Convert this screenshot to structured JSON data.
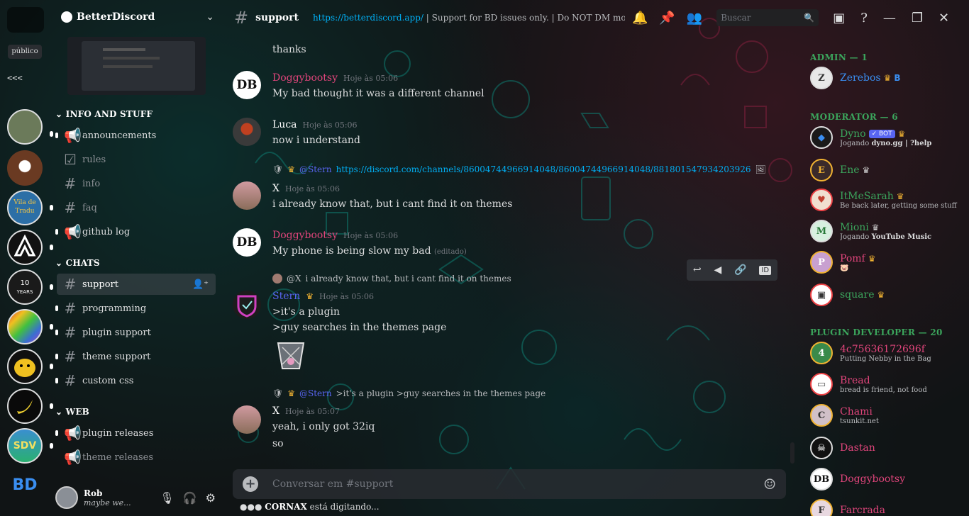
{
  "rail": {
    "publico_label": "público",
    "collapse_label": "<<<",
    "servers": [
      {
        "name": "server-landscape",
        "color": "#6b7a5a"
      },
      {
        "name": "server-flower",
        "color": "#6a3a22"
      },
      {
        "name": "server-vila-tradu",
        "label": "Vila\nTradu",
        "color": "#2c6fa6"
      },
      {
        "name": "server-arch",
        "color": "#111111"
      },
      {
        "name": "server-10-years",
        "label": "10 YEARS",
        "color": "#1a1a1a"
      },
      {
        "name": "server-plug",
        "color": "#3a6fd0"
      },
      {
        "name": "server-bird",
        "color": "#f0c020"
      },
      {
        "name": "server-banana",
        "color": "#0a0a0a"
      },
      {
        "name": "server-sdv",
        "label": "SDV",
        "color": "#3a8fd0"
      },
      {
        "name": "server-bd",
        "label": "BD",
        "color": "#3a8ef0"
      }
    ]
  },
  "sidebar": {
    "guild_name": "BetterDiscord",
    "categories": [
      {
        "label": "INFO AND STUFF"
      },
      {
        "label": "CHATS"
      },
      {
        "label": "WEB"
      }
    ],
    "channels": {
      "announcements": "announcements",
      "rules": "rules",
      "info": "info",
      "faq": "faq",
      "github_log": "github log",
      "support": "support",
      "programming": "programming",
      "plugin_support": "plugin support",
      "theme_support": "theme support",
      "custom_css": "custom css",
      "plugin_releases": "plugin releases",
      "theme_releases": "theme releases"
    },
    "user": {
      "name": "Rob",
      "status": "maybe we..."
    }
  },
  "topbar": {
    "channel": "support",
    "topic_link": "https://betterdiscord.app/",
    "topic_text": " | Support for BD issues only. | Do NOT DM mods/use...",
    "search_placeholder": "Buscar"
  },
  "messages": [
    {
      "key": "m0",
      "body": "thanks"
    },
    {
      "key": "m1",
      "author": "Doggybootsy",
      "author_color": "#e0457b",
      "time": "Hoje às 05:06",
      "body": "My bad thought it was a different channel"
    },
    {
      "key": "m2",
      "author": "Luca",
      "author_color": "#ffffff",
      "time": "Hoje às 05:06",
      "body": "now i understand"
    },
    {
      "key": "m3",
      "reply_to": "@Stern",
      "reply_link": "https://discord.com/channels/86004744966914048/86004744966914048/881801547934203926",
      "author": "X",
      "author_color": "#ffffff",
      "time": "Hoje às 05:06",
      "body": "i already know that, but i cant find it on themes"
    },
    {
      "key": "m4",
      "author": "Doggybootsy",
      "author_color": "#e0457b",
      "time": "Hoje às 05:06",
      "body": "My phone is being slow my bad",
      "edited": "(editado)"
    },
    {
      "key": "m5",
      "reply_to": "@X",
      "reply_text": "i already know that, but i cant find it on themes",
      "author": "Stern",
      "author_color": "#5865f2",
      "time": "Hoje às 05:06",
      "body1": ">it's a plugin",
      "body2": ">guy searches in the themes page"
    },
    {
      "key": "m6",
      "reply_to": "@Stern",
      "reply_text": ">it's a plugin >guy searches in the themes page",
      "author": "X",
      "author_color": "#ffffff",
      "time": "Hoje às 05:07",
      "body1": "yeah, i only got 32iq",
      "body2": "so"
    }
  ],
  "composer": {
    "placeholder": "Conversar em #support"
  },
  "typing": {
    "user": "CORNAX",
    "text": " está digitando..."
  },
  "members": {
    "roles": [
      {
        "label": "ADMIN — 1"
      },
      {
        "label": "MODERATOR — 6"
      },
      {
        "label": "PLUGIN DEVELOPER — 20"
      }
    ],
    "list": [
      {
        "name": "Zerebos",
        "color": "#3a8ef0",
        "activity": ""
      },
      {
        "name": "Dyno",
        "color": "#3ba55c",
        "badge": "BOT",
        "activity_prefix": "Jogando ",
        "activity": "dyno.gg | ?help"
      },
      {
        "name": "Ene",
        "color": "#3ba55c",
        "activity": ""
      },
      {
        "name": "ItMeSarah",
        "color": "#3ba55c",
        "activity": "Be back later, getting some stuff do..."
      },
      {
        "name": "Mioni",
        "color": "#3ba55c",
        "activity_prefix": "Jogando ",
        "activity": "YouTube Music"
      },
      {
        "name": "Pomf",
        "color": "#e0457b",
        "activity": ""
      },
      {
        "name": "square",
        "color": "#3ba55c",
        "activity": ""
      },
      {
        "name": "4c75636172696f",
        "color": "#e0457b",
        "activity": "Putting Nebby in the Bag"
      },
      {
        "name": "Bread",
        "color": "#e0457b",
        "activity": "bread is friend, not food"
      },
      {
        "name": "Chami",
        "color": "#e0457b",
        "activity": "tsunkit.net"
      },
      {
        "name": "Dastan",
        "color": "#e0457b",
        "activity": ""
      },
      {
        "name": "Doggybootsy",
        "color": "#e0457b",
        "activity": ""
      },
      {
        "name": "Farcrada",
        "color": "#e0457b",
        "activity": ""
      }
    ]
  }
}
